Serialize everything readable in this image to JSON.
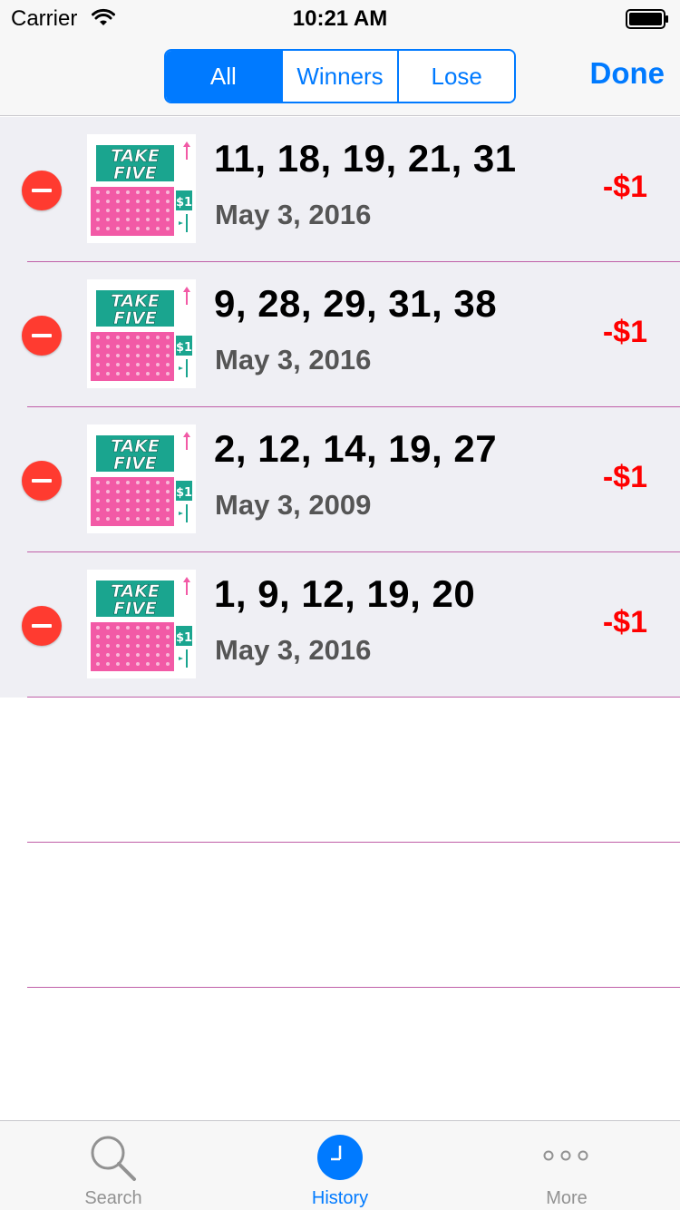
{
  "status_bar": {
    "carrier": "Carrier",
    "time": "10:21 AM",
    "wifi_icon": "wifi-icon",
    "battery_icon": "battery-icon"
  },
  "nav": {
    "segments": [
      {
        "label": "All",
        "selected": true
      },
      {
        "label": "Winners",
        "selected": false
      },
      {
        "label": "Lose",
        "selected": false
      }
    ],
    "done_label": "Done"
  },
  "tickets": [
    {
      "numbers": "11, 18, 19, 21, 31",
      "date": "May 3, 2016",
      "amount": "-$1",
      "logo": [
        "TAKE",
        "FIVE"
      ],
      "price": "$1"
    },
    {
      "numbers": "9, 28, 29, 31, 38",
      "date": "May 3, 2016",
      "amount": "-$1",
      "logo": [
        "TAKE",
        "FIVE"
      ],
      "price": "$1"
    },
    {
      "numbers": "2, 12, 14, 19, 27",
      "date": "May 3, 2009",
      "amount": "-$1",
      "logo": [
        "TAKE",
        "FIVE"
      ],
      "price": "$1"
    },
    {
      "numbers": "1, 9, 12, 19, 20",
      "date": "May 3, 2016",
      "amount": "-$1",
      "logo": [
        "TAKE",
        "FIVE"
      ],
      "price": "$1"
    }
  ],
  "tab_bar": {
    "tabs": [
      {
        "label": "Search",
        "icon": "search-icon",
        "active": false
      },
      {
        "label": "History",
        "icon": "clock-icon",
        "active": true
      },
      {
        "label": "More",
        "icon": "more-icon",
        "active": false
      }
    ]
  },
  "colors": {
    "accent": "#007aff",
    "delete": "#ff3b30",
    "loss": "#ff0000",
    "row_bg": "#efeff4",
    "separator": "#c05fa8",
    "ticket_teal": "#1aa58f",
    "ticket_pink": "#f25aa6"
  }
}
